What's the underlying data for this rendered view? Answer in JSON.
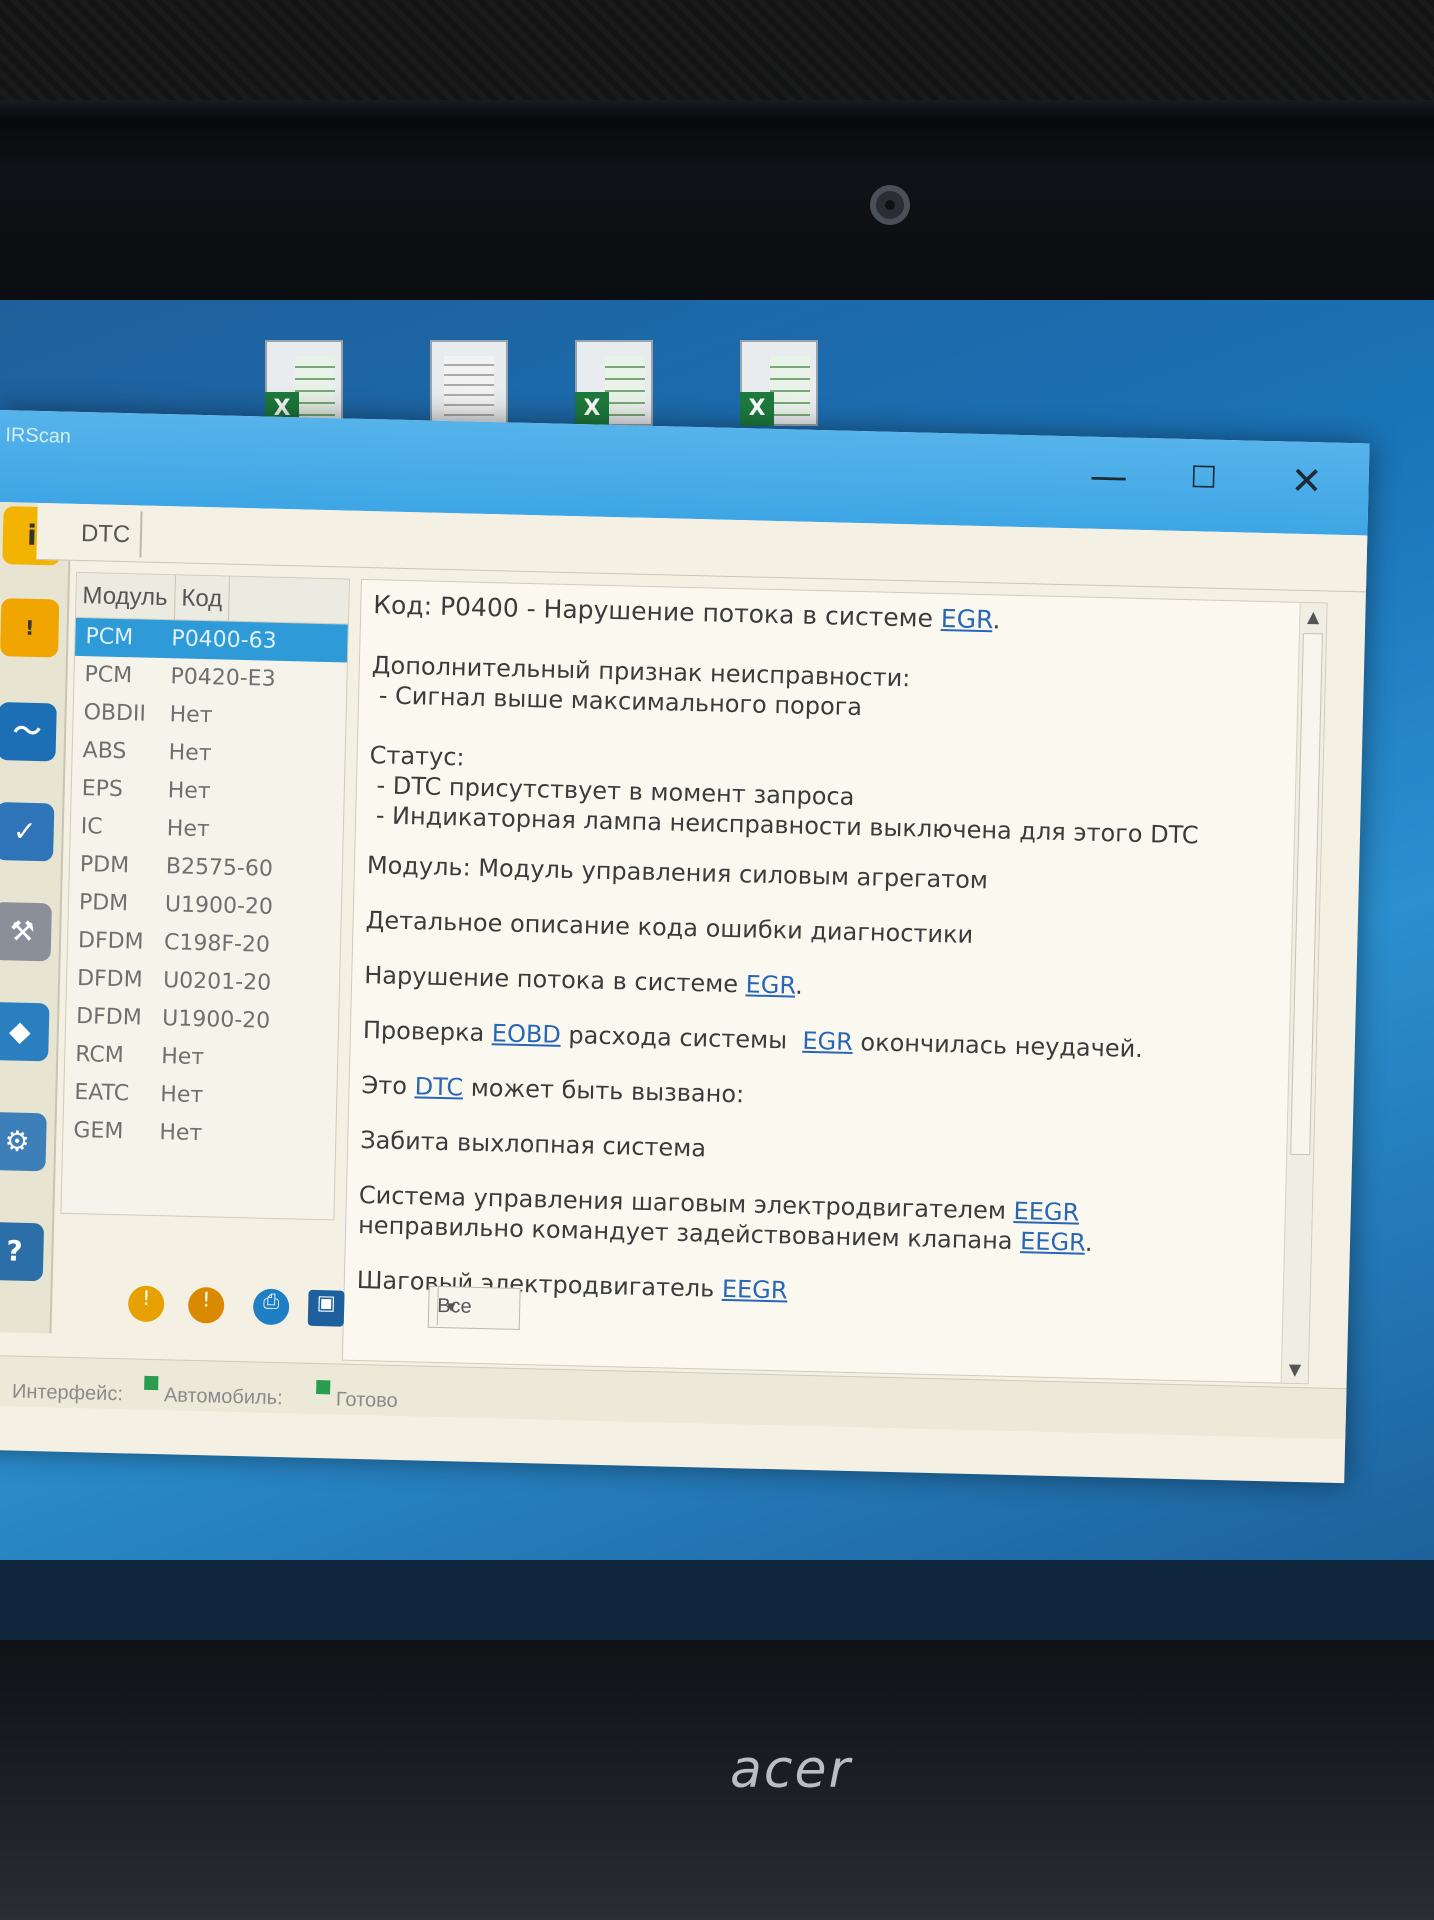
{
  "window": {
    "app_title": "IRScan",
    "tab": "DTC",
    "minimize": "—",
    "maximize": "☐",
    "close": "✕"
  },
  "list": {
    "headers": [
      "Модуль",
      "Код"
    ],
    "rows": [
      {
        "module": "PCM",
        "code": "P0400-63",
        "selected": true
      },
      {
        "module": "PCM",
        "code": "P0420-E3"
      },
      {
        "module": "OBDII",
        "code": "Нет"
      },
      {
        "module": "ABS",
        "code": "Нет"
      },
      {
        "module": "EPS",
        "code": "Нет"
      },
      {
        "module": "IC",
        "code": "Нет"
      },
      {
        "module": "PDM",
        "code": "B2575-60"
      },
      {
        "module": "PDM",
        "code": "U1900-20"
      },
      {
        "module": "DFDM",
        "code": "C198F-20"
      },
      {
        "module": "DFDM",
        "code": "U0201-20"
      },
      {
        "module": "DFDM",
        "code": "U1900-20"
      },
      {
        "module": "RCM",
        "code": "Нет"
      },
      {
        "module": "EATC",
        "code": "Нет"
      },
      {
        "module": "GEM",
        "code": "Нет"
      }
    ]
  },
  "details": {
    "title_prefix": "Код: P0400 - Нарушение потока в системе ",
    "title_link": "EGR",
    "title_suffix": ".",
    "symptom_label": "Дополнительный признак неисправности:",
    "symptom_item": " - Сигнал выше максимального порога",
    "status_label": "Статус:",
    "status_item1": " - DTC присутствует в момент запроса",
    "status_item2": " - Индикаторная лампа неисправности выключена для этого DTC",
    "module_line": "Модуль: Модуль управления силовым агрегатом",
    "desc_label": "Детальное описание кода ошибки диагностики",
    "desc_line_prefix": "Нарушение потока в системе ",
    "desc_line_link": "EGR",
    "desc_line_suffix": ".",
    "check_prefix": "Проверка ",
    "check_link1": "EOBD",
    "check_mid": " расхода системы  ",
    "check_link2": "EGR",
    "check_suffix": " окончилась неудачей.",
    "cause_prefix": "Это ",
    "cause_link": "DTC",
    "cause_suffix": " может быть вызвано:",
    "cause1": "Забита выхлопная система",
    "cause2_a": "Система управления шаговым электродвигателем ",
    "cause2_link1": "EEGR",
    "cause2_b": " неправильно командует задействованием клапана ",
    "cause2_link2": "EEGR",
    "cause2_c": ".",
    "cause3_prefix": "Шаговый электродвигатель ",
    "cause3_link": "EEGR"
  },
  "toolbar": {
    "filter_value": "Все"
  },
  "status": {
    "interface": "Интерфейс:",
    "vehicle": "Автомобиль:",
    "ready": "Готово"
  },
  "brand": "acer",
  "colors": {
    "titlebar": "#3ea6e6",
    "selection": "#2e9ad8",
    "link": "#2866b8",
    "status_dot": "#2c9d4e"
  }
}
